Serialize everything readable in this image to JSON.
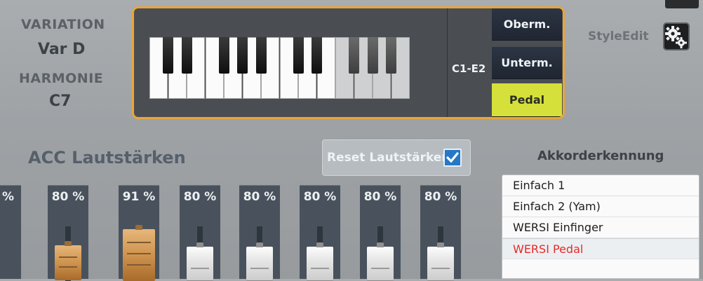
{
  "variation": {
    "label": "VARIATION",
    "value": "Var D"
  },
  "harmonie": {
    "label": "HARMONIE",
    "value": "C7"
  },
  "keyboard": {
    "range": "C1-E2",
    "manuals": [
      "Oberm.",
      "Unterm.",
      "Pedal"
    ],
    "active_manual": "Pedal"
  },
  "styleedit": {
    "label": "StyleEdit"
  },
  "acc": {
    "title": "ACC Lautstärken",
    "reset_label": "Reset Lautstärken",
    "reset_checked": true,
    "faders": [
      {
        "label": "%",
        "level": null,
        "partial": true
      },
      {
        "label": "80 %",
        "level": 80,
        "color": "orange"
      },
      {
        "label": "91 %",
        "level": 91,
        "color": "orange"
      },
      {
        "label": "80 %",
        "level": 80,
        "color": "white"
      },
      {
        "label": "80 %",
        "level": 80,
        "color": "white"
      },
      {
        "label": "80 %",
        "level": 80,
        "color": "white"
      },
      {
        "label": "80 %",
        "level": 80,
        "color": "white"
      },
      {
        "label": "80 %",
        "level": 80,
        "color": "white"
      }
    ]
  },
  "akkorderkennung": {
    "title": "Akkorderkennung",
    "options": [
      "Einfach 1",
      "Einfach 2 (Yam)",
      "WERSI Einfinger",
      "WERSI Pedal"
    ],
    "selected": "WERSI Pedal"
  },
  "colors": {
    "accent": "#e9a53a",
    "active_button": "#d6e03a",
    "selected_text": "#e52a2a",
    "fader_orange": "#cf944e",
    "checkbox": "#2678c6"
  }
}
